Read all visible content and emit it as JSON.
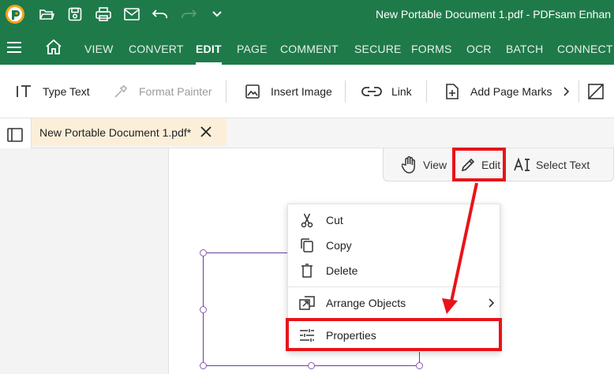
{
  "titlebar": {
    "title": "New Portable Document 1.pdf  -  PDFsam Enhan"
  },
  "menubar": {
    "items": [
      "VIEW",
      "CONVERT",
      "EDIT",
      "PAGE",
      "COMMENT",
      "SECURE",
      "FORMS",
      "OCR",
      "BATCH",
      "CONNECT"
    ],
    "active": "EDIT"
  },
  "toolbar": {
    "type_text": "Type Text",
    "format_painter": "Format Painter",
    "insert_image": "Insert Image",
    "link": "Link",
    "add_page_marks": "Add Page Marks"
  },
  "tab": {
    "label": "New Portable Document 1.pdf*"
  },
  "modes": {
    "view": "View",
    "edit": "Edit",
    "select_text": "Select Text"
  },
  "context_menu": {
    "items": [
      "Cut",
      "Copy",
      "Delete",
      "Arrange Objects",
      "Properties"
    ]
  },
  "colors": {
    "brand_green": "#1f7a4a",
    "highlight_red": "#e8141a",
    "tab_bg": "#fcefd9",
    "shape_stroke": "#6a3d8f"
  }
}
